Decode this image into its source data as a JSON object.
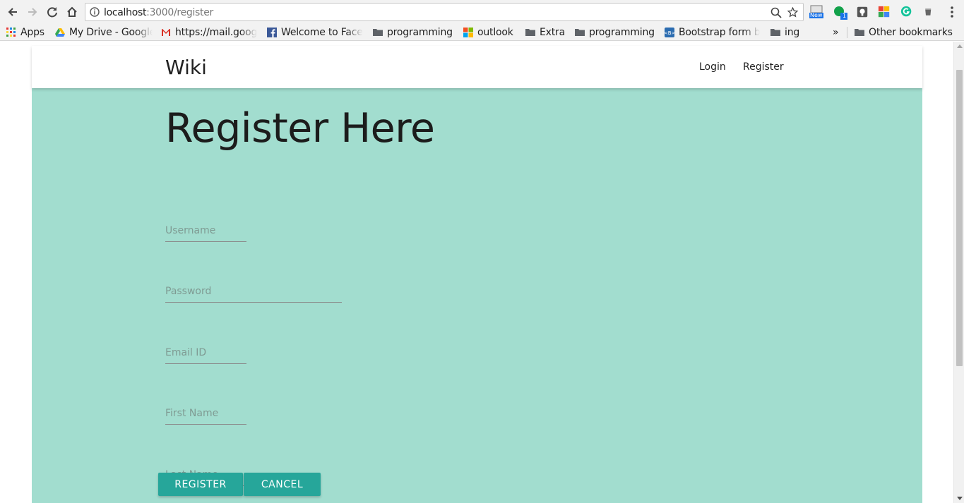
{
  "browser": {
    "url_host": "localhost",
    "url_path": ":3000/register",
    "new_badge": "New",
    "notif_count": "1"
  },
  "bookmarks": {
    "apps": "Apps",
    "my_drive": "My Drive - Google",
    "gmail": "https://mail.goog",
    "facebook": "Welcome to Face",
    "programming1": "programming",
    "outlook": "outlook",
    "extra": "Extra",
    "programming2": "programming",
    "bootstrap": "Bootstrap form b",
    "ing": "ing",
    "overflow": "»",
    "other": "Other bookmarks"
  },
  "navbar": {
    "brand": "Wiki",
    "login": "Login",
    "register": "Register"
  },
  "form": {
    "heading": "Register Here",
    "username_placeholder": "Username",
    "password_placeholder": "Password",
    "email_placeholder": "Email ID",
    "firstname_placeholder": "First Name",
    "lastname_placeholder": "Last Name",
    "register_label": "REGISTER",
    "cancel_label": "CANCEL"
  },
  "colors": {
    "content_bg": "#a2ddcf",
    "button_bg": "#26a69a"
  }
}
